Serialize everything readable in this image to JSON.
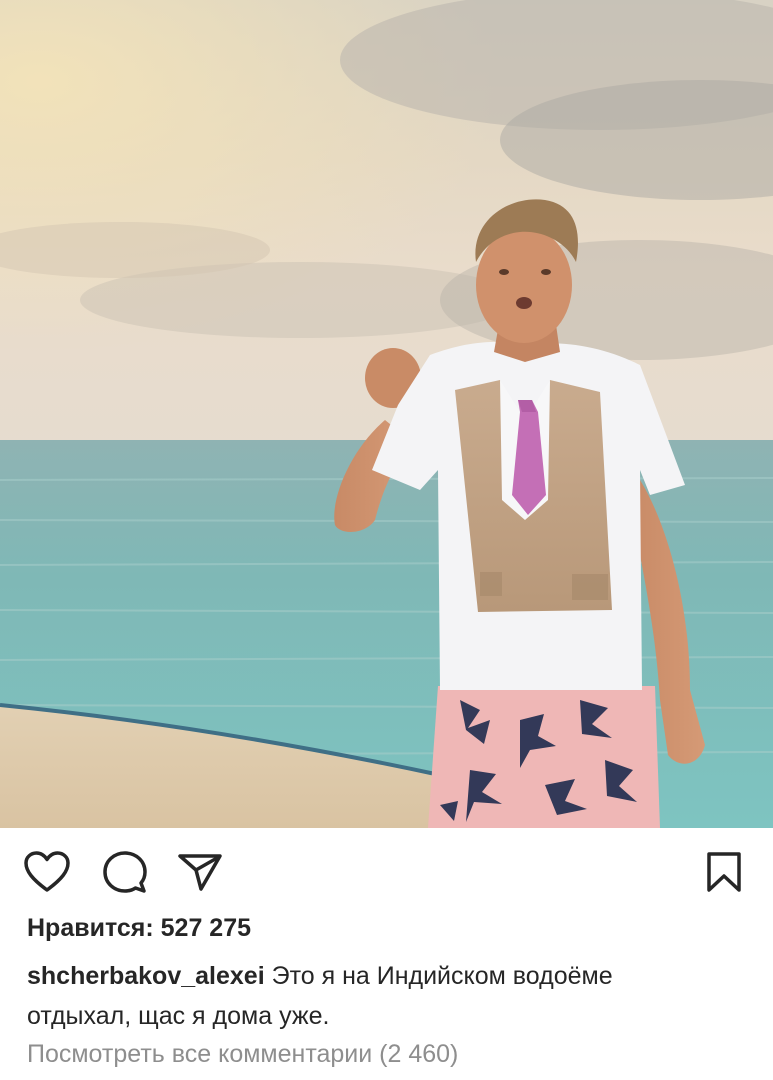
{
  "post": {
    "photo_icon": "post-photo",
    "actions": {
      "like_icon": "heart-outline-icon",
      "comment_icon": "comment-bubble-icon",
      "share_icon": "paper-plane-icon",
      "save_icon": "bookmark-outline-icon"
    },
    "likes_label": "Нравится: 527 275",
    "caption": {
      "username": "shcherbakov_alexei",
      "text_line1": " Это я на Индийском водоёме",
      "text_line2": "отдыхал, щас я дома уже."
    },
    "view_comments_label": "Посмотреть все комментарии (2 460)"
  }
}
